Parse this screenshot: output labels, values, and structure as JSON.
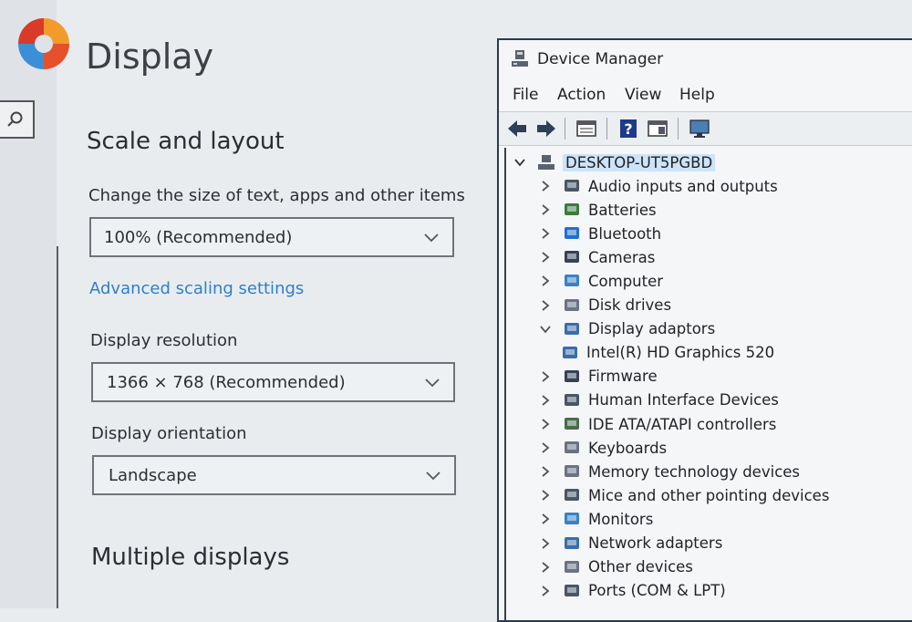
{
  "settings": {
    "page_title": "Display",
    "section_scale": "Scale and layout",
    "scale_label": "Change the size of text, apps and other items",
    "scale_value": "100% (Recommended)",
    "advanced_link": "Advanced scaling settings",
    "resolution_label": "Display resolution",
    "resolution_value": "1366 × 768 (Recommended)",
    "orientation_label": "Display orientation",
    "orientation_value": "Landscape",
    "section_multiple": "Multiple displays"
  },
  "device_manager": {
    "title": "Device Manager",
    "menu": [
      "File",
      "Action",
      "View",
      "Help"
    ],
    "toolbar_icons": [
      "back-arrow-icon",
      "forward-arrow-icon",
      "properties-icon",
      "help-icon",
      "update-driver-icon",
      "monitor-icon"
    ],
    "root": "DESKTOP-UT5PGBD",
    "items": [
      {
        "label": "Audio inputs and outputs",
        "icon": "speaker-icon",
        "expanded": false
      },
      {
        "label": "Batteries",
        "icon": "battery-icon",
        "expanded": false
      },
      {
        "label": "Bluetooth",
        "icon": "bluetooth-icon",
        "expanded": false
      },
      {
        "label": "Cameras",
        "icon": "camera-icon",
        "expanded": false
      },
      {
        "label": "Computer",
        "icon": "computer-icon",
        "expanded": false
      },
      {
        "label": "Disk drives",
        "icon": "disk-icon",
        "expanded": false
      },
      {
        "label": "Display adaptors",
        "icon": "display-adapter-icon",
        "expanded": true
      },
      {
        "label": "Intel(R) HD Graphics 520",
        "icon": "display-adapter-icon",
        "child": true
      },
      {
        "label": "Firmware",
        "icon": "firmware-icon",
        "expanded": false
      },
      {
        "label": "Human Interface Devices",
        "icon": "hid-icon",
        "expanded": false
      },
      {
        "label": "IDE ATA/ATAPI controllers",
        "icon": "ide-icon",
        "expanded": false
      },
      {
        "label": "Keyboards",
        "icon": "keyboard-icon",
        "expanded": false
      },
      {
        "label": "Memory technology devices",
        "icon": "memory-icon",
        "expanded": false
      },
      {
        "label": "Mice and other pointing devices",
        "icon": "mouse-icon",
        "expanded": false
      },
      {
        "label": "Monitors",
        "icon": "monitor-icon",
        "expanded": false
      },
      {
        "label": "Network adapters",
        "icon": "network-icon",
        "expanded": false
      },
      {
        "label": "Other devices",
        "icon": "other-devices-icon",
        "expanded": false
      },
      {
        "label": "Ports (COM & LPT)",
        "icon": "port-icon",
        "expanded": false
      }
    ]
  },
  "colors": {
    "link": "#2f7fc8",
    "selection": "#cde3f7",
    "window_border": "#2c3a4f"
  }
}
